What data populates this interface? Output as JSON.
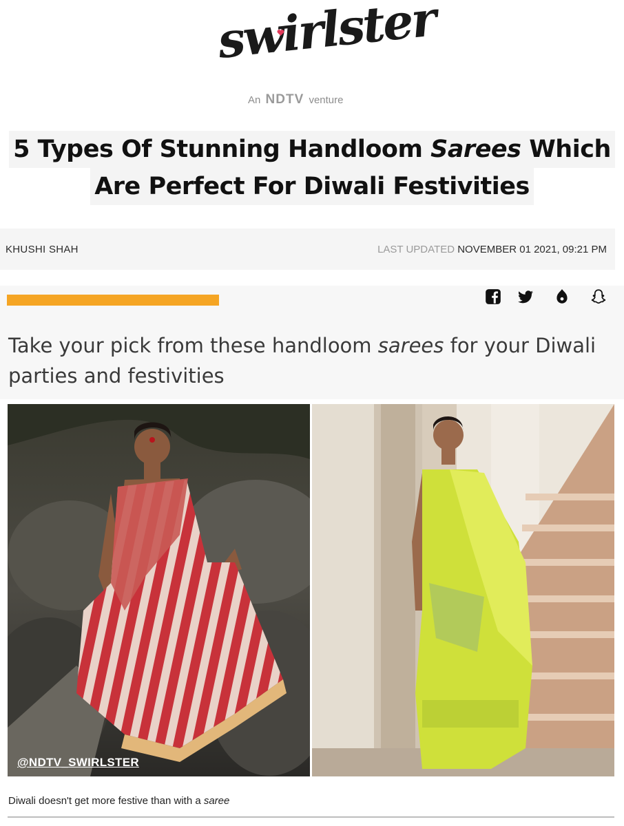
{
  "brand": {
    "logo_text": "swirlster",
    "tagline_prefix": "An",
    "tagline_brand": "NDTV",
    "tagline_suffix": "venture",
    "accent_color": "#e23a5a"
  },
  "headline": {
    "line1_part1": "5 Types Of Stunning Handloom ",
    "line1_italic": "Sarees",
    "line1_part2": " Which",
    "line2": "Are Perfect For Diwali Festivities"
  },
  "byline": {
    "author": "KHUSHI SHAH",
    "updated_label": "LAST UPDATED",
    "updated_date": "NOVEMBER 01 2021, 09:21 PM"
  },
  "share": {
    "icons": [
      "facebook-icon",
      "twitter-icon",
      "sharechat-icon",
      "snapchat-icon"
    ],
    "accent_bar_color": "#f5a524"
  },
  "article": {
    "subheading_part1": "Take your pick from these handloom ",
    "subheading_italic": "sarees",
    "subheading_part2": " for your Diwali parties and festivities",
    "watermark": "@NDTV_SWIRLSTER",
    "caption_part1": "Diwali doesn't get more festive than with a ",
    "caption_italic": "saree"
  }
}
